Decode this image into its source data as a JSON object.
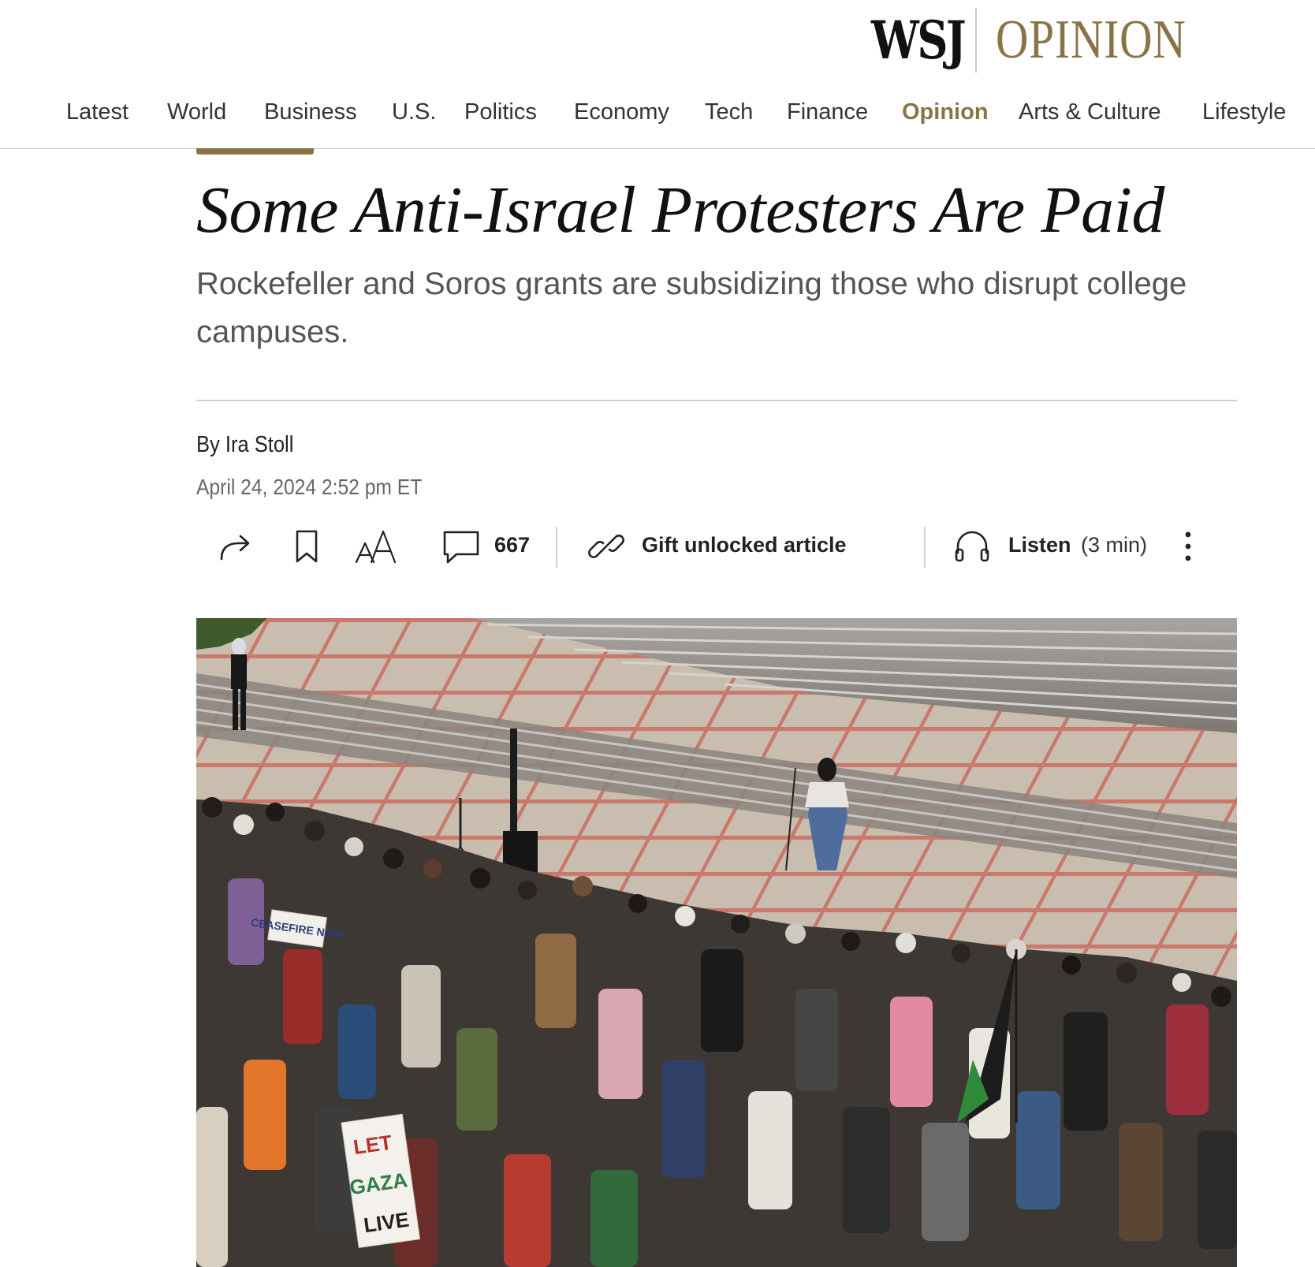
{
  "masthead": {
    "wsj": "WSJ",
    "section": "OPINION"
  },
  "nav": {
    "items": [
      {
        "label": "Latest",
        "active": false
      },
      {
        "label": "World",
        "active": false
      },
      {
        "label": "Business",
        "active": false
      },
      {
        "label": "U.S.",
        "active": false
      },
      {
        "label": "Politics",
        "active": false
      },
      {
        "label": "Economy",
        "active": false
      },
      {
        "label": "Tech",
        "active": false
      },
      {
        "label": "Finance",
        "active": false
      },
      {
        "label": "Opinion",
        "active": true
      },
      {
        "label": "Arts & Culture",
        "active": false
      },
      {
        "label": "Lifestyle",
        "active": false
      }
    ]
  },
  "article": {
    "headline": "Some Anti-Israel Protesters Are Paid",
    "dek": "Rockefeller and Soros grants are subsidizing those who disrupt college campuses.",
    "byline_prefix": "By ",
    "author": "Ira Stoll",
    "date": "April 24, 2024 2:52 pm ET"
  },
  "toolbar": {
    "share_icon": "share-arrow-icon",
    "bookmark_icon": "bookmark-icon",
    "text_size_icon": "text-size-icon",
    "comments_icon": "comment-bubble-icon",
    "comment_count": "667",
    "gift_icon": "link-icon",
    "gift_label": "Gift unlocked article",
    "listen_icon": "headphones-icon",
    "listen_label": "Listen",
    "listen_duration": "(3 min)",
    "more_icon": "more-vertical-icon"
  },
  "colors": {
    "accent": "#8a7447",
    "text": "#111111",
    "muted": "#555555",
    "divider": "#cfcfcf"
  },
  "photo": {
    "signs": [
      "CEASEFIRE NOW",
      "LET GAZA LIVE"
    ]
  }
}
